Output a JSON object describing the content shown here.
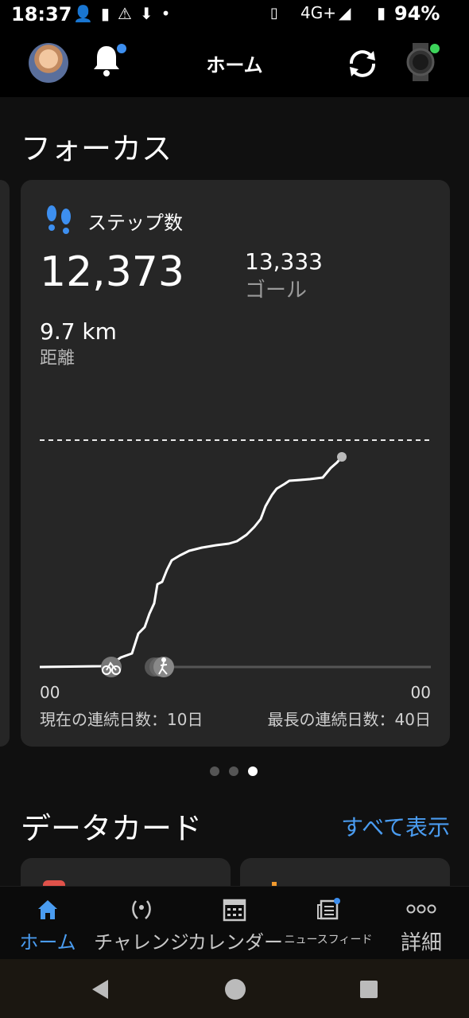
{
  "status": {
    "time": "18:37",
    "network": "4G+",
    "battery": "94%"
  },
  "header": {
    "title": "ホーム"
  },
  "focus": {
    "section_title": "フォーカス",
    "card": {
      "label": "ステップ数",
      "steps": "12,373",
      "goal_value": "13,333",
      "goal_label": "ゴール",
      "distance_value": "9.7 km",
      "distance_label": "距離",
      "axis_start": "00",
      "axis_end": "00",
      "current_streak": "現在の連続日数：10日",
      "longest_streak": "最長の連続日数：40日"
    },
    "pager": {
      "count": 3,
      "active": 2
    }
  },
  "data_cards": {
    "section_title": "データカード",
    "see_all": "すべて表示"
  },
  "bottom_nav": {
    "tabs": [
      {
        "label": "ホーム",
        "icon": "home-icon",
        "active": true
      },
      {
        "label": "チャレンジ",
        "icon": "laurel-icon",
        "active": false
      },
      {
        "label": "カレンダー",
        "icon": "calendar-icon",
        "active": false
      },
      {
        "label": "ニュースフィード",
        "icon": "newsfeed-icon",
        "active": false
      },
      {
        "label": "詳細",
        "icon": "more-icon",
        "active": false
      }
    ]
  },
  "colors": {
    "accent": "#4a9cf0",
    "card_bg": "#262626",
    "page_bg": "#101010"
  }
}
